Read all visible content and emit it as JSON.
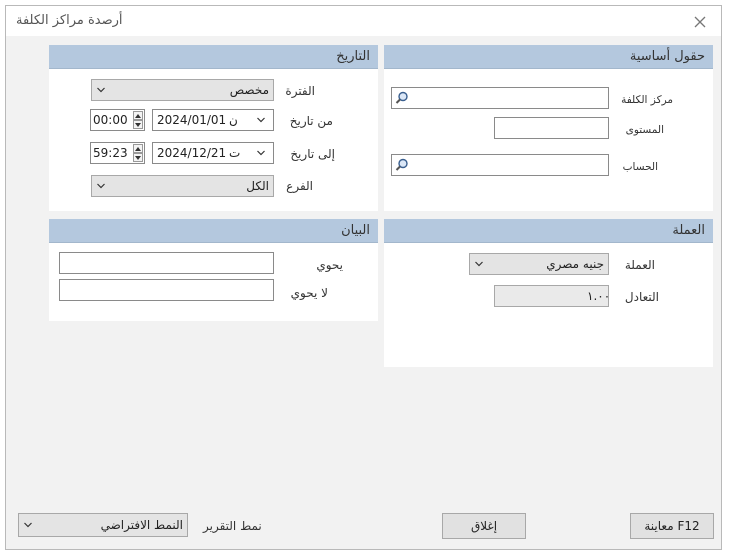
{
  "window": {
    "title": "أرصدة مراكز الكلفة"
  },
  "basic_fields": {
    "header": "حقول أساسية",
    "cost_center_label": "مركز الكلفة",
    "level_label": "المستوى",
    "account_label": "الحساب"
  },
  "date_panel": {
    "header": "التاريخ",
    "period_label": "الفترة",
    "period_value": "مخصص",
    "from_label": "من تاريخ",
    "from_date": "2024/01/01",
    "from_day": "ن",
    "from_time": "00:00",
    "to_label": "إلى تاريخ",
    "to_date": "2024/12/21",
    "to_day": "ت",
    "to_time": "59:23",
    "branch_label": "الفرع",
    "branch_value": "الكل"
  },
  "currency_panel": {
    "header": "العملة",
    "currency_label": "العملة",
    "currency_value": "جنيه مصري",
    "rate_label": "التعادل",
    "rate_value": "١.٠٠"
  },
  "statement_panel": {
    "header": "البيان",
    "contains_label": "يحوي",
    "not_contains_label": "لا يحوي"
  },
  "footer": {
    "preview_button": "معاينة F12",
    "close_button": "إغلاق",
    "report_style_label": "نمط التقرير",
    "report_style_value": "النمط الافتراضي"
  }
}
